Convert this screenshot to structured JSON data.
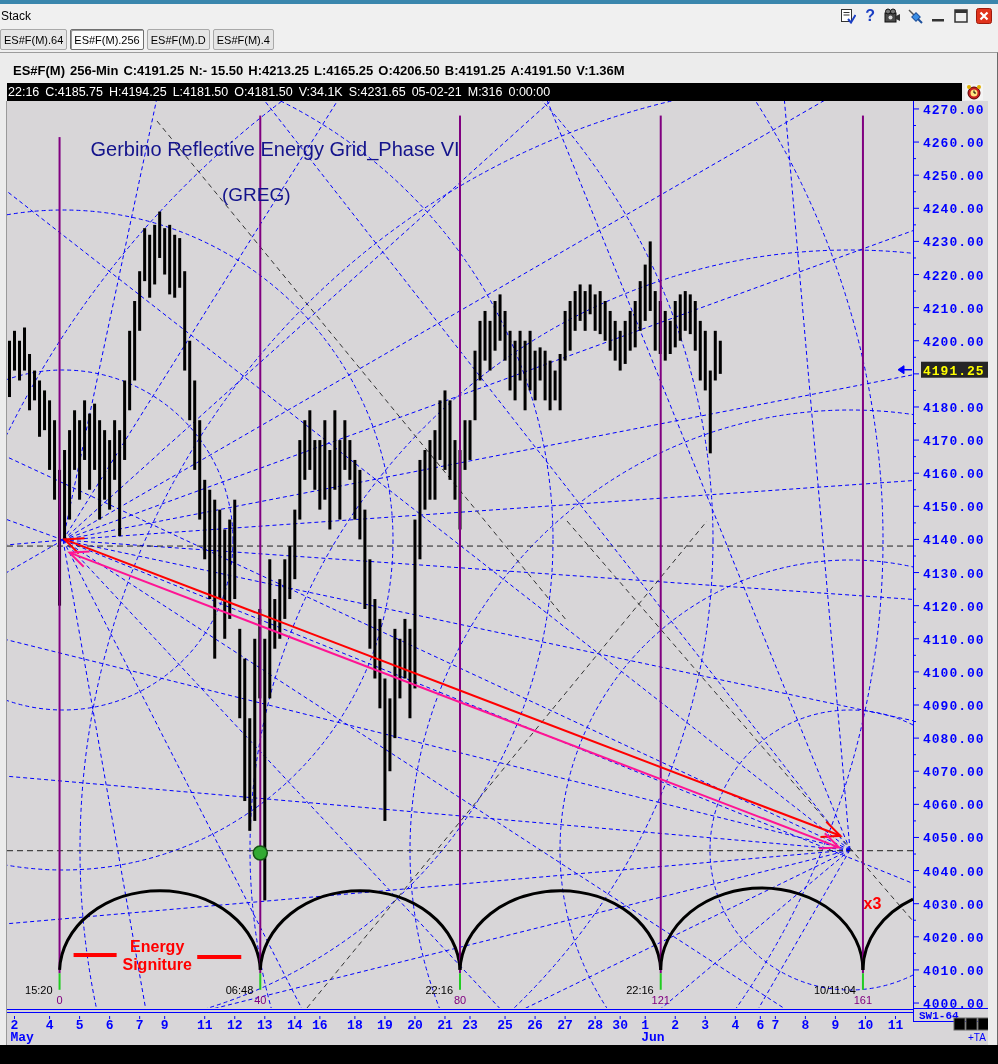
{
  "title_bar": {
    "title": "Stack",
    "help": "?"
  },
  "tabs": [
    {
      "label": "ES#F(M).64",
      "selected": false
    },
    {
      "label": "ES#F(M).256",
      "selected": true
    },
    {
      "label": "ES#F(M).D",
      "selected": false
    },
    {
      "label": "ES#F(M).4",
      "selected": false
    }
  ],
  "quote_line": [
    "ES#F(M)",
    "256-Min",
    "C:4191.25",
    "N:- 15.50",
    "H:4213.25",
    "L:4165.25",
    "O:4206.50",
    "B:4191.25",
    "A:4191.50",
    "V:1.36M"
  ],
  "bar_info": [
    "22:16",
    "C:4185.75",
    "H:4194.25",
    "L:4181.50",
    "O:4181.50",
    "V:34.1K",
    "S:4231.65",
    "05-02-21",
    "M:316",
    "0:00:00"
  ],
  "chart": {
    "title": "Gerbino Reflective Energy Grid_Phase VI",
    "subtitle": "(GREG)",
    "price_labels": [
      "4270.00",
      "4260.00",
      "4250.00",
      "4240.00",
      "4230.00",
      "4220.00",
      "4210.00",
      "4200.00",
      "4180.00",
      "4170.00",
      "4160.00",
      "4150.00",
      "4140.00",
      "4130.00",
      "4120.00",
      "4110.00",
      "4100.00",
      "4090.00",
      "4080.00",
      "4070.00",
      "4060.00",
      "4050.00",
      "4040.00",
      "4030.00",
      "4020.00",
      "4010.00",
      "4000.00"
    ],
    "price_tag": "4191.25",
    "date_labels": [
      "2",
      "4",
      "5",
      "6",
      "7",
      "9",
      "11",
      "12",
      "13",
      "14",
      "16",
      "18",
      "19",
      "20",
      "21",
      "23",
      "25",
      "26",
      "27",
      "28",
      "30",
      "1",
      "2",
      "3",
      "4",
      "6",
      "7",
      "8",
      "9",
      "10",
      "11"
    ],
    "months": [
      "May",
      "Jun"
    ],
    "cycles": [
      {
        "count": "0",
        "time": "15:20"
      },
      {
        "count": "40",
        "time": "06:48"
      },
      {
        "count": "80",
        "time": "22:16"
      },
      {
        "count": "121",
        "time": "22:16"
      },
      {
        "count": "161",
        "time": "10/11:04"
      }
    ],
    "labels": [
      {
        "text": "Energy Signiture",
        "kind": "flanked"
      },
      {
        "text": "x3",
        "kind": "plain"
      }
    ],
    "study_label": "SW1-64",
    "corner_label": "+TA"
  }
}
